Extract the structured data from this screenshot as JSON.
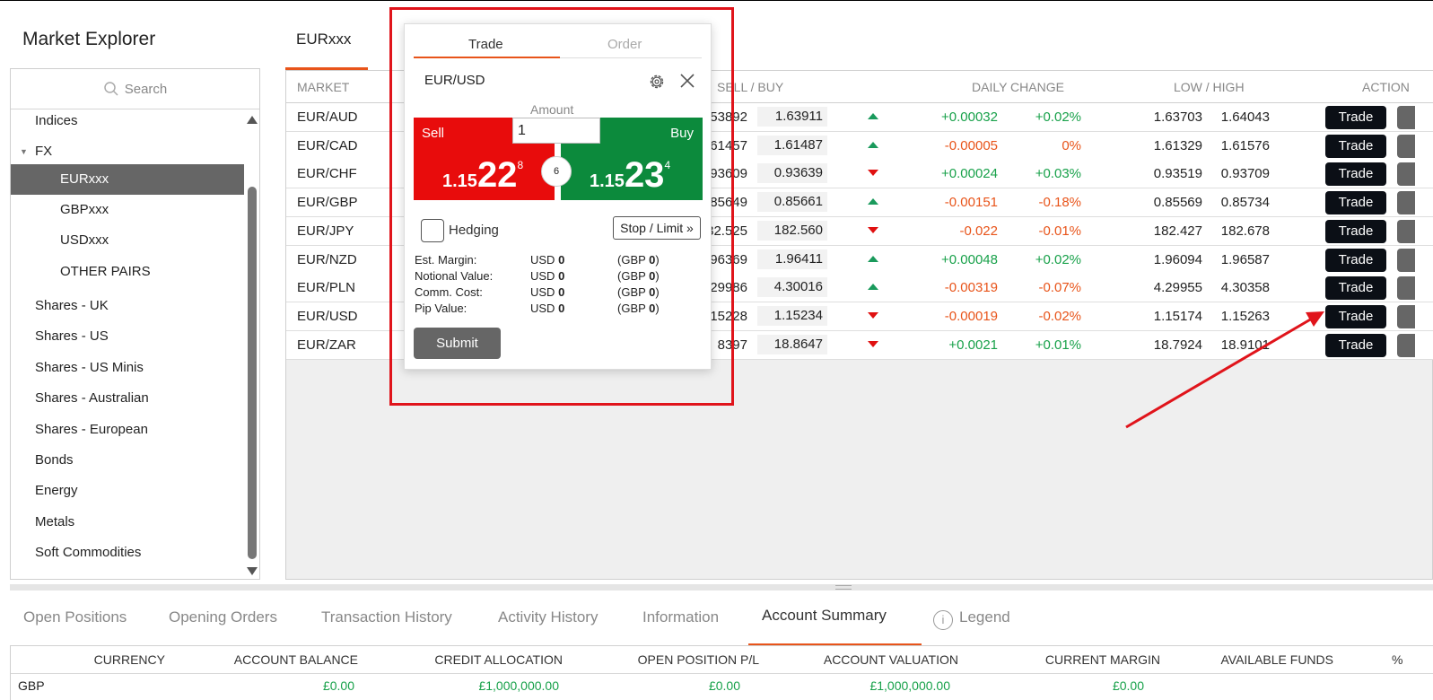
{
  "explorer": {
    "title": "Market Explorer",
    "search_placeholder": "Search",
    "items": [
      {
        "label": "Indices",
        "level": 1,
        "selected": false,
        "caret": false
      },
      {
        "label": "FX",
        "level": 1,
        "selected": false,
        "caret": true
      },
      {
        "label": "EURxxx",
        "level": 2,
        "selected": true,
        "caret": false
      },
      {
        "label": "GBPxxx",
        "level": 2,
        "selected": false,
        "caret": false
      },
      {
        "label": "USDxxx",
        "level": 2,
        "selected": false,
        "caret": false
      },
      {
        "label": "OTHER PAIRS",
        "level": 2,
        "selected": false,
        "caret": false
      },
      {
        "label": "Shares - UK",
        "level": 1,
        "selected": false,
        "caret": false
      },
      {
        "label": "Shares - US",
        "level": 1,
        "selected": false,
        "caret": false
      },
      {
        "label": "Shares - US Minis",
        "level": 1,
        "selected": false,
        "caret": false
      },
      {
        "label": "Shares - Australian",
        "level": 1,
        "selected": false,
        "caret": false
      },
      {
        "label": "Shares - European",
        "level": 1,
        "selected": false,
        "caret": false
      },
      {
        "label": "Bonds",
        "level": 1,
        "selected": false,
        "caret": false
      },
      {
        "label": "Energy",
        "level": 1,
        "selected": false,
        "caret": false
      },
      {
        "label": "Metals",
        "level": 1,
        "selected": false,
        "caret": false
      },
      {
        "label": "Soft Commodities",
        "level": 1,
        "selected": false,
        "caret": false
      }
    ]
  },
  "market_tab": "EURxxx",
  "table": {
    "headers": {
      "market": "MARKET",
      "sell_buy": "SELL / BUY",
      "daily_change": "DAILY CHANGE",
      "low_high": "LOW / HIGH",
      "action": "ACTION"
    },
    "rows": [
      {
        "market": "EUR/AUD",
        "sell": "53892",
        "buy": "1.63911",
        "trend": "up",
        "change": "+0.00032",
        "pct": "+0.02%",
        "sign": "pos",
        "low": "1.63703",
        "high": "1.64043",
        "action": "Trade"
      },
      {
        "market": "EUR/CAD",
        "sell": "61457",
        "buy": "1.61487",
        "trend": "up",
        "change": "-0.00005",
        "pct": "0%",
        "sign": "neg",
        "low": "1.61329",
        "high": "1.61576",
        "action": "Trade"
      },
      {
        "market": "EUR/CHF",
        "sell": "93609",
        "buy": "0.93639",
        "trend": "down",
        "change": "+0.00024",
        "pct": "+0.03%",
        "sign": "pos",
        "low": "0.93519",
        "high": "0.93709",
        "action": "Trade"
      },
      {
        "market": "EUR/GBP",
        "sell": "85649",
        "buy": "0.85661",
        "trend": "up",
        "change": "-0.00151",
        "pct": "-0.18%",
        "sign": "neg",
        "low": "0.85569",
        "high": "0.85734",
        "action": "Trade"
      },
      {
        "market": "EUR/JPY",
        "sell": "32.525",
        "buy": "182.560",
        "trend": "down",
        "change": "-0.022",
        "pct": "-0.01%",
        "sign": "neg",
        "low": "182.427",
        "high": "182.678",
        "action": "Trade"
      },
      {
        "market": "EUR/NZD",
        "sell": "96369",
        "buy": "1.96411",
        "trend": "up",
        "change": "+0.00048",
        "pct": "+0.02%",
        "sign": "pos",
        "low": "1.96094",
        "high": "1.96587",
        "action": "Trade"
      },
      {
        "market": "EUR/PLN",
        "sell": "29986",
        "buy": "4.30016",
        "trend": "up",
        "change": "-0.00319",
        "pct": "-0.07%",
        "sign": "neg",
        "low": "4.29955",
        "high": "4.30358",
        "action": "Trade"
      },
      {
        "market": "EUR/USD",
        "sell": "15228",
        "buy": "1.15234",
        "trend": "down",
        "change": "-0.00019",
        "pct": "-0.02%",
        "sign": "neg",
        "low": "1.15174",
        "high": "1.15263",
        "action": "Trade"
      },
      {
        "market": "EUR/ZAR",
        "sell": "8397",
        "buy": "18.8647",
        "trend": "down",
        "change": "+0.0021",
        "pct": "+0.01%",
        "sign": "pos",
        "low": "18.7924",
        "high": "18.9101",
        "action": "Trade"
      }
    ]
  },
  "ticket": {
    "tab_trade": "Trade",
    "tab_order": "Order",
    "pair": "EUR/USD",
    "amount_label": "Amount",
    "amount_value": "1",
    "sell_label": "Sell",
    "buy_label": "Buy",
    "sell_price": {
      "small": "1.15",
      "big": "22",
      "sup": "8"
    },
    "buy_price": {
      "small": "1.15",
      "big": "23",
      "sup": "4"
    },
    "spread": "6",
    "hedging_label": "Hedging",
    "hedging_checked": false,
    "stop_limit_label": "Stop / Limit »",
    "info": [
      {
        "label": "Est. Margin:",
        "usd_prefix": "USD",
        "usd": "0",
        "gbp_prefix": "(GBP",
        "gbp": "0",
        "close": ")"
      },
      {
        "label": "Notional Value:",
        "usd_prefix": "USD",
        "usd": "0",
        "gbp_prefix": "(GBP",
        "gbp": "0",
        "close": ")"
      },
      {
        "label": "Comm. Cost:",
        "usd_prefix": "USD",
        "usd": "0",
        "gbp_prefix": "(GBP",
        "gbp": "0",
        "close": ")"
      },
      {
        "label": "Pip Value:",
        "usd_prefix": "USD",
        "usd": "0",
        "gbp_prefix": "(GBP",
        "gbp": "0",
        "close": ")"
      }
    ],
    "submit_label": "Submit"
  },
  "bottom": {
    "tabs": [
      "Open Positions",
      "Opening Orders",
      "Transaction History",
      "Activity History",
      "Information",
      "Account Summary",
      "Legend"
    ],
    "active_tab": "Account Summary",
    "legend_icon_glyph": "i",
    "headers": [
      "CURRENCY",
      "ACCOUNT BALANCE",
      "CREDIT ALLOCATION",
      "OPEN POSITION P/L",
      "ACCOUNT VALUATION",
      "CURRENT MARGIN",
      "AVAILABLE FUNDS",
      "%"
    ],
    "row": [
      "GBP",
      "£0.00",
      "£1,000,000.00",
      "£0.00",
      "£1,000,000.00",
      "£0.00"
    ]
  },
  "colors": {
    "accent": "#e8541a",
    "sell": "#e80c0c",
    "buy": "#0c8a3c",
    "positive": "#18a14a",
    "negative": "#e8541a",
    "annotation": "#e0141b"
  }
}
